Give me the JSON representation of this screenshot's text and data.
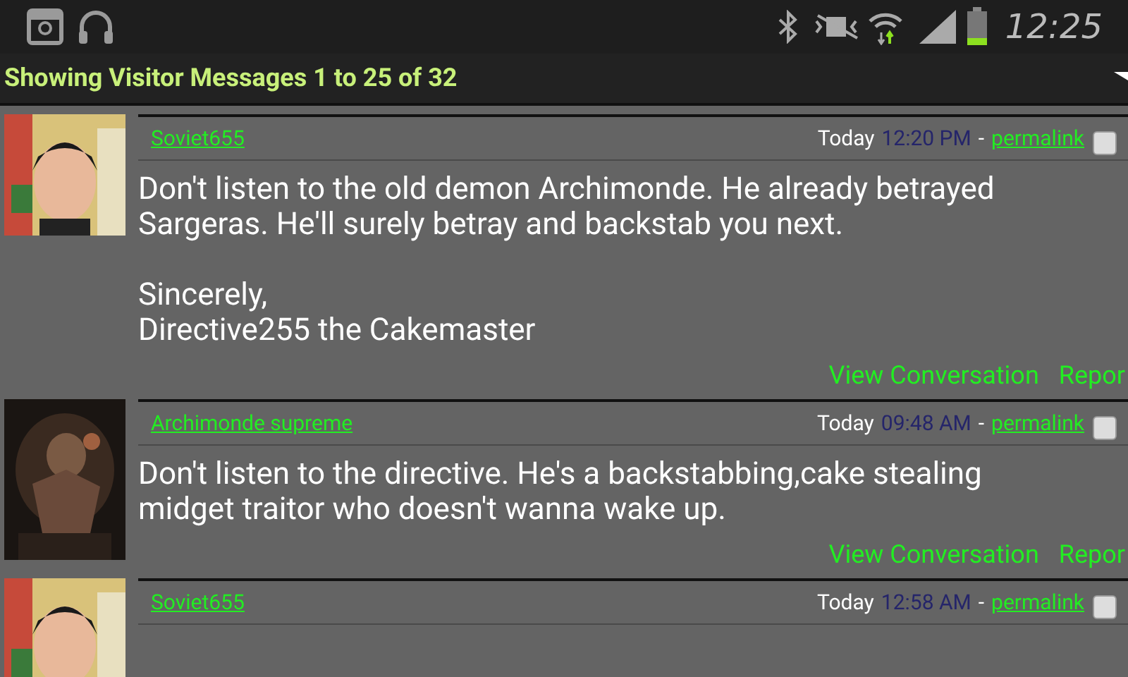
{
  "status_bar": {
    "time": "12:25"
  },
  "header": {
    "title": "Showing Visitor Messages 1 to 25 of 32"
  },
  "messages": [
    {
      "author": "Soviet655",
      "day": "Today",
      "time": "12:20 PM",
      "separator": "-",
      "permalink": "permalink",
      "checked": false,
      "avatar": {
        "kind": "picture"
      },
      "body": "Don't listen to the old demon Archimonde. He already betrayed Sargeras. He'll surely betray and backstab you next.\n\nSincerely,\nDirective255 the Cakemaster",
      "actions": [
        "View Conversation",
        "Repor"
      ]
    },
    {
      "author": "Archimonde supreme",
      "day": "Today",
      "time": "09:48 AM",
      "separator": "-",
      "permalink": "permalink",
      "checked": false,
      "avatar": {
        "kind": "picture"
      },
      "body": "Don't listen to the directive. He's a backstabbing,cake stealing midget traitor who doesn't wanna wake up.",
      "actions": [
        "View Conversation",
        "Repor"
      ]
    },
    {
      "author": "Soviet655",
      "day": "Today",
      "time": "12:58 AM",
      "separator": "-",
      "permalink": "permalink",
      "checked": false,
      "avatar": {
        "kind": "picture"
      }
    }
  ]
}
